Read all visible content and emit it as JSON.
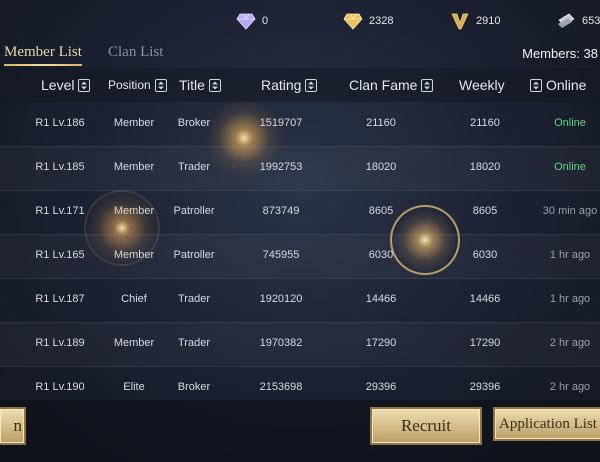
{
  "currencies": [
    {
      "name": "crystal",
      "icon": "purple-diamond-icon",
      "value": "0",
      "color": "#b9a6ff"
    },
    {
      "name": "gold_diamond",
      "icon": "gold-diamond-icon",
      "value": "2328",
      "color": "#e7c15a"
    },
    {
      "name": "v_token",
      "icon": "gold-v-icon",
      "value": "2910",
      "color": "#d9ac4e"
    },
    {
      "name": "ticket",
      "icon": "silver-ticket-icon",
      "value": "653",
      "color": "#c9ccd6"
    }
  ],
  "tabs": [
    {
      "label": "Member List",
      "active": true
    },
    {
      "label": "Clan List",
      "active": false
    }
  ],
  "members_count": "Members: 38",
  "columns": [
    "Level",
    "Position",
    "Title",
    "Rating",
    "Clan Fame",
    "Weekly",
    "Online"
  ],
  "rows": [
    {
      "level": "R1 Lv.186",
      "position": "Member",
      "title": "Broker",
      "rating": "1519707",
      "fame": "21160",
      "weekly": "21160",
      "online": "Online",
      "is_online": true
    },
    {
      "level": "R1 Lv.185",
      "position": "Member",
      "title": "Trader",
      "rating": "1992753",
      "fame": "18020",
      "weekly": "18020",
      "online": "Online",
      "is_online": true
    },
    {
      "level": "R1 Lv.171",
      "position": "Member",
      "title": "Patroller",
      "rating": "873749",
      "fame": "8605",
      "weekly": "8605",
      "online": "30 min ago",
      "is_online": false
    },
    {
      "level": "R1 Lv.165",
      "position": "Member",
      "title": "Patroller",
      "rating": "745955",
      "fame": "6030",
      "weekly": "6030",
      "online": "1 hr ago",
      "is_online": false
    },
    {
      "level": "R1 Lv.187",
      "position": "Chief",
      "title": "Trader",
      "rating": "1920120",
      "fame": "14466",
      "weekly": "14466",
      "online": "1 hr ago",
      "is_online": false
    },
    {
      "level": "R1 Lv.189",
      "position": "Member",
      "title": "Trader",
      "rating": "1970382",
      "fame": "17290",
      "weekly": "17290",
      "online": "2 hr ago",
      "is_online": false
    },
    {
      "level": "R1 Lv.190",
      "position": "Elite",
      "title": "Broker",
      "rating": "2153698",
      "fame": "29396",
      "weekly": "29396",
      "online": "2 hr ago",
      "is_online": false
    }
  ],
  "buttons": {
    "left_partial": "n",
    "recruit": "Recruit",
    "application_list": "Application List"
  },
  "colors": {
    "accent_gold": "#e8d6a8",
    "online_green": "#5fd47a"
  }
}
